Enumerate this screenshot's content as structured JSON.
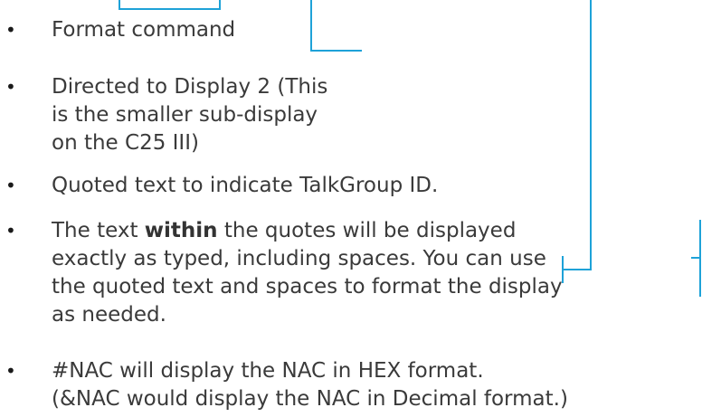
{
  "bullets": [
    {
      "lines": [
        "Format command"
      ]
    },
    {
      "lines": [
        "Directed to Display 2 (This",
        "is the smaller sub-display",
        "on the C25 III)"
      ]
    },
    {
      "lines": [
        "Quoted text to indicate TalkGroup ID."
      ]
    },
    {
      "pre": "The text ",
      "bold": "within",
      "post": " the quotes will be displayed",
      "lines": [
        "exactly as typed, including spaces.  You can use",
        "the quoted text and spaces to format the display",
        "as needed."
      ]
    },
    {
      "lines": [
        "#NAC will display the NAC in HEX format.",
        "(&NAC would display the NAC in Decimal format.)"
      ]
    }
  ],
  "bullet_symbol": "•",
  "connector_color": "#1ea2d8"
}
